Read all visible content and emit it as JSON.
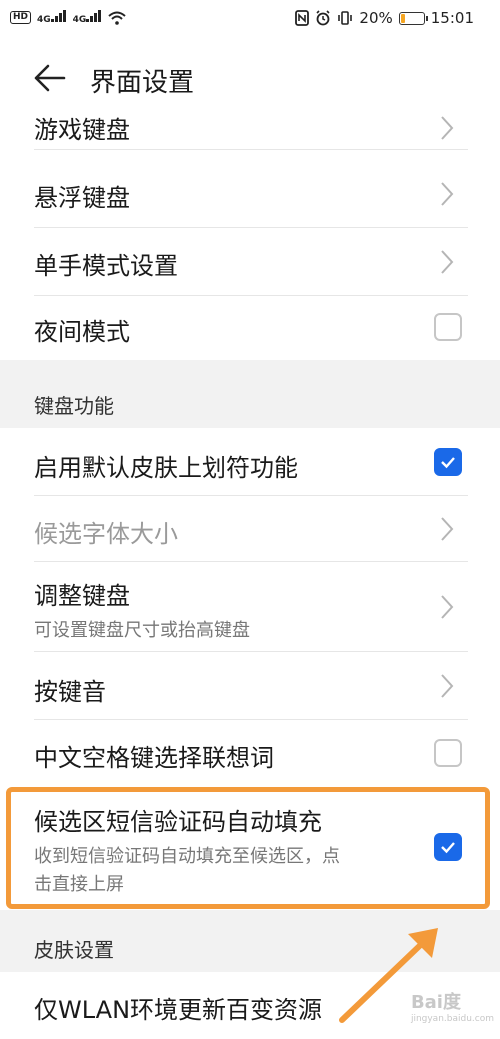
{
  "status_bar": {
    "hd": "HD",
    "signal_1": "4G",
    "signal_2": "4G",
    "battery_percent": "20%",
    "battery_level": 0.2,
    "time": "15:01"
  },
  "header": {
    "title": "界面设置"
  },
  "rows_top": [
    {
      "label": "游戏键盘"
    },
    {
      "label": "悬浮键盘"
    },
    {
      "label": "单手模式设置"
    },
    {
      "label": "夜间模式"
    }
  ],
  "sections": {
    "keyboard": "键盘功能",
    "skin": "皮肤设置"
  },
  "rows_keyboard": [
    {
      "label": "启用默认皮肤上划符功能"
    },
    {
      "label": "候选字体大小"
    },
    {
      "label": "调整键盘",
      "sub": "可设置键盘尺寸或抬高键盘"
    },
    {
      "label": "按键音"
    },
    {
      "label": "中文空格键选择联想词"
    },
    {
      "label": "候选区短信验证码自动填充",
      "sub_line1": "收到短信验证码自动填充至候选区，点",
      "sub_line2": "击直接上屏"
    }
  ],
  "rows_skin": [
    {
      "label": "仅WLAN环境更新百变资源"
    }
  ],
  "colors": {
    "accent": "#1a69e8",
    "highlight": "#f39a3a",
    "section_bg": "#f2f2f2"
  },
  "watermark": {
    "text": "Bai度",
    "sub": "jingyan.baidu.com"
  }
}
